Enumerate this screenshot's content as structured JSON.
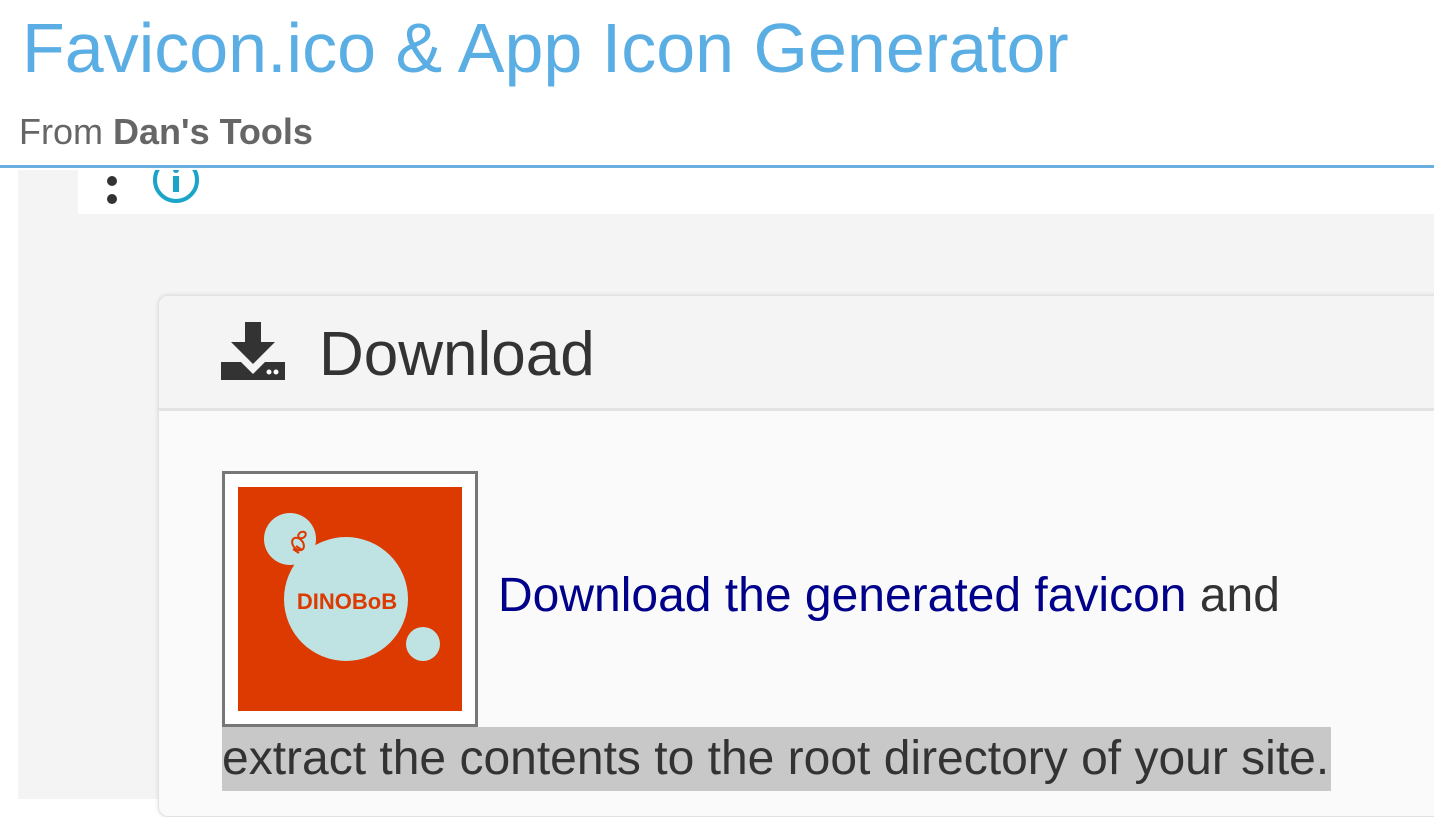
{
  "header": {
    "title": "Favicon.ico & App Icon Generator",
    "subtitle_prefix": "From",
    "subtitle_brand": "Dan's Tools"
  },
  "toolbar": {
    "more_icon": "kebab-menu-icon",
    "info_icon": "info-icon"
  },
  "download_card": {
    "title": "Download",
    "icon": "download-icon",
    "favicon_logo_text": "DINOBoB",
    "link_text": "Download the generated favicon",
    "after_link_text": " and",
    "instruction_text": "extract the contents to the root directory of your site."
  },
  "colors": {
    "title_blue": "#5aaee3",
    "link_navy": "#00008b",
    "logo_orange": "#dc3a00",
    "logo_bubble": "#bfe3e3",
    "info_cyan": "#1ba4c9"
  }
}
